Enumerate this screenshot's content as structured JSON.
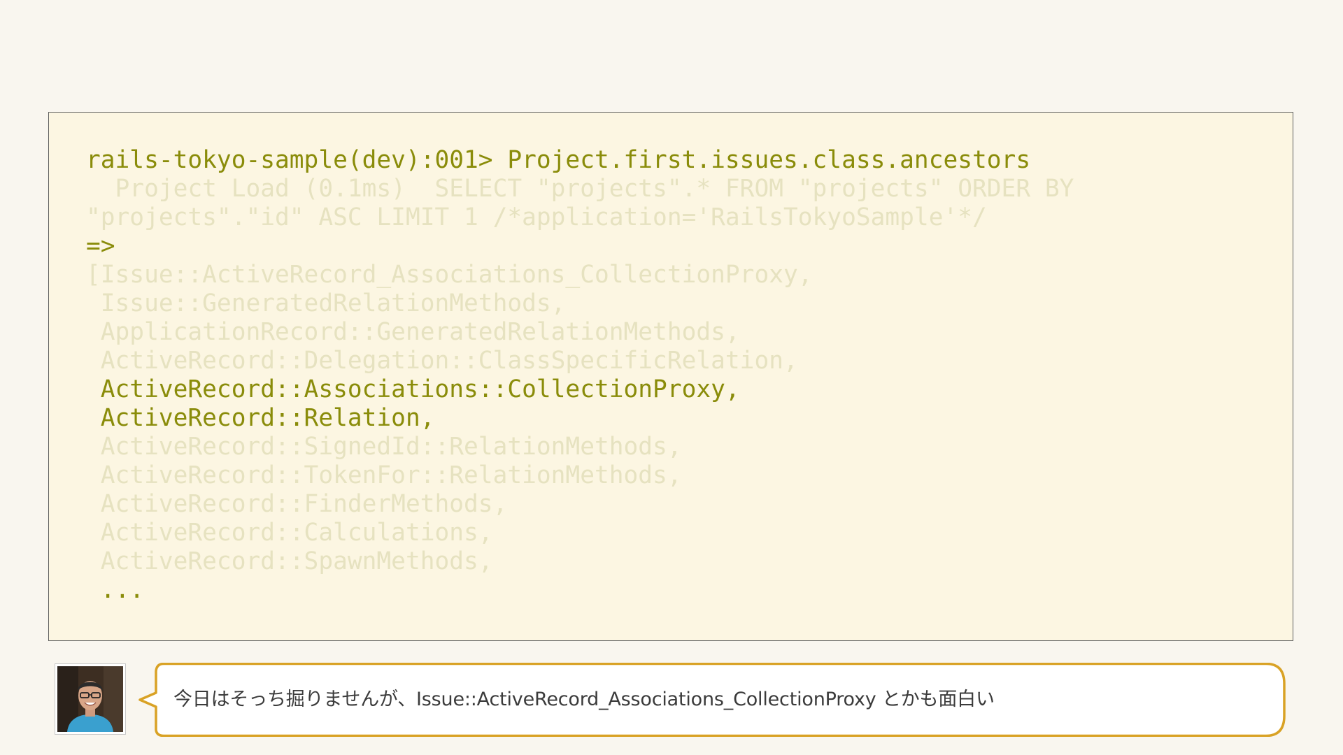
{
  "code_block": {
    "lines": [
      {
        "text": "rails-tokyo-sample(dev):001> Project.first.issues.class.ancestors",
        "emphasis": "highlight"
      },
      {
        "text": "  Project Load (0.1ms)  SELECT \"projects\".* FROM \"projects\" ORDER BY",
        "emphasis": "dim"
      },
      {
        "text": "\"projects\".\"id\" ASC LIMIT 1 /*application='RailsTokyoSample'*/",
        "emphasis": "dim"
      },
      {
        "text": "=>",
        "emphasis": "highlight"
      },
      {
        "text": "[Issue::ActiveRecord_Associations_CollectionProxy,",
        "emphasis": "dim"
      },
      {
        "text": " Issue::GeneratedRelationMethods,",
        "emphasis": "dim"
      },
      {
        "text": " ApplicationRecord::GeneratedRelationMethods,",
        "emphasis": "dim"
      },
      {
        "text": " ActiveRecord::Delegation::ClassSpecificRelation,",
        "emphasis": "dim"
      },
      {
        "text": " ActiveRecord::Associations::CollectionProxy,",
        "emphasis": "highlight"
      },
      {
        "text": " ActiveRecord::Relation,",
        "emphasis": "highlight"
      },
      {
        "text": " ActiveRecord::SignedId::RelationMethods,",
        "emphasis": "dim"
      },
      {
        "text": " ActiveRecord::TokenFor::RelationMethods,",
        "emphasis": "dim"
      },
      {
        "text": " ActiveRecord::FinderMethods,",
        "emphasis": "dim"
      },
      {
        "text": " ActiveRecord::Calculations,",
        "emphasis": "dim"
      },
      {
        "text": " ActiveRecord::SpawnMethods,",
        "emphasis": "dim"
      },
      {
        "text": " ...",
        "emphasis": "highlight"
      }
    ]
  },
  "speaker": {
    "avatar_icon": "speaker-photo",
    "comment": "今日はそっち掘りませんが、Issue::ActiveRecord_Associations_CollectionProxy とかも面白い"
  },
  "colors": {
    "page_background": "#f9f6ef",
    "code_background": "#fcf6e2",
    "code_highlight": "#8a8c0a",
    "code_dim": "#e6e2c0",
    "bubble_border": "#d9a225",
    "bubble_text": "#3b3b3b"
  }
}
